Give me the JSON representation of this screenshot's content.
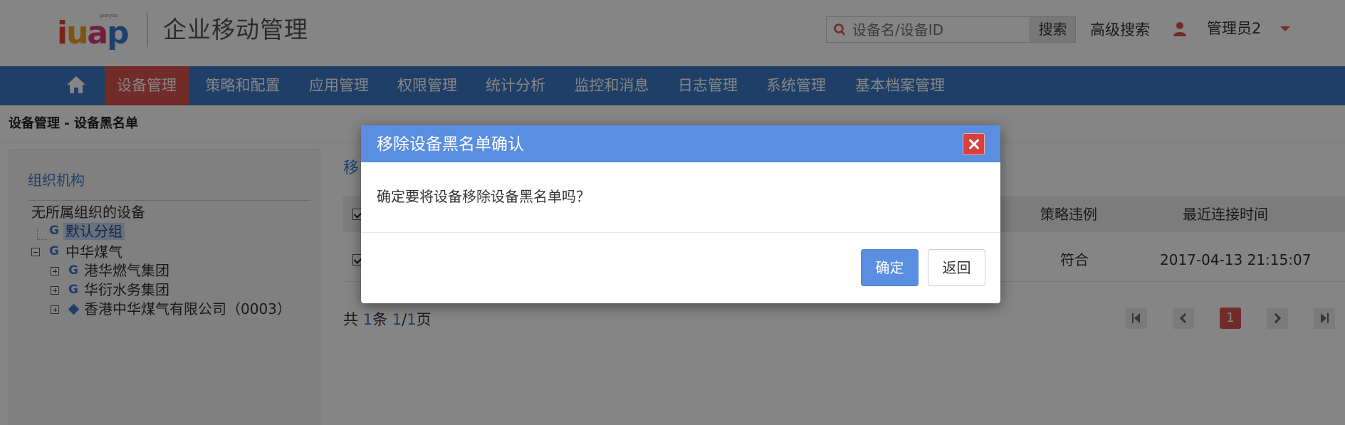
{
  "header": {
    "logo_small": "yonyou",
    "logo_text": "iuap",
    "app_title": "企业移动管理",
    "search_placeholder": "设备名/设备ID",
    "search_button": "搜索",
    "advanced_search": "高级搜索",
    "user_name": "管理员2"
  },
  "nav": {
    "home_icon": "home-icon",
    "items": [
      {
        "label": "设备管理",
        "active": true
      },
      {
        "label": "策略和配置"
      },
      {
        "label": "应用管理"
      },
      {
        "label": "权限管理"
      },
      {
        "label": "统计分析"
      },
      {
        "label": "监控和消息"
      },
      {
        "label": "日志管理"
      },
      {
        "label": "系统管理"
      },
      {
        "label": "基本档案管理"
      }
    ]
  },
  "breadcrumb": "设备管理 -  设备黑名单",
  "org_panel": {
    "title": "组织机构",
    "tree": [
      {
        "label": "无所属组织的设备"
      },
      {
        "label": "默认分组",
        "selected": true
      },
      {
        "label": "中华煤气"
      },
      {
        "label": "港华燃气集团"
      },
      {
        "label": "华衍水务集团"
      },
      {
        "label": "香港中华煤气有限公司（0003）"
      }
    ]
  },
  "main": {
    "title_fragment": "移",
    "columns": {
      "policy_violation": "策略违例",
      "last_connect": "最近连接时间"
    },
    "rows": [
      {
        "policy_violation": "符合",
        "last_connect": "2017-04-13 21:15:07"
      }
    ],
    "pager": {
      "prefix": "共",
      "total": "1",
      "unit_items": "条",
      "page": "1",
      "sep": "/",
      "pages": "1",
      "unit_pages": "页",
      "current_page": "1"
    }
  },
  "modal": {
    "title": "移除设备黑名单确认",
    "message": "确定要将设备移除设备黑名单吗？",
    "confirm_label": "确定",
    "back_label": "返回"
  },
  "colors": {
    "nav_bg": "#3d79c8",
    "active_red": "#d9534f",
    "modal_header": "#5a8ee0"
  }
}
